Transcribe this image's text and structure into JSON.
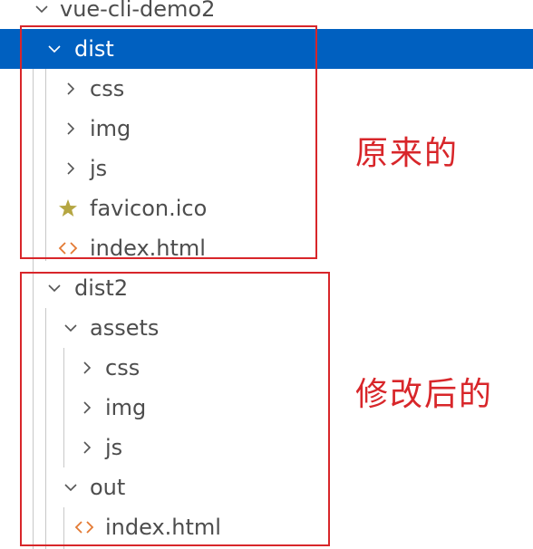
{
  "tree": {
    "root": {
      "label": "vue-cli-demo2",
      "icon": "chevron-down-icon"
    },
    "dist": {
      "label": "dist",
      "icon": "chevron-down-icon",
      "children": [
        {
          "label": "css",
          "icon": "chevron-right-icon"
        },
        {
          "label": "img",
          "icon": "chevron-right-icon"
        },
        {
          "label": "js",
          "icon": "chevron-right-icon"
        },
        {
          "label": "favicon.ico",
          "icon": "star-icon"
        },
        {
          "label": "index.html",
          "icon": "html-code-icon"
        }
      ]
    },
    "dist2": {
      "label": "dist2",
      "icon": "chevron-down-icon",
      "assets": {
        "label": "assets",
        "icon": "chevron-down-icon",
        "children": [
          {
            "label": "css",
            "icon": "chevron-right-icon"
          },
          {
            "label": "img",
            "icon": "chevron-right-icon"
          },
          {
            "label": "js",
            "icon": "chevron-right-icon"
          }
        ]
      },
      "out": {
        "label": "out",
        "icon": "chevron-down-icon",
        "children": [
          {
            "label": "index.html",
            "icon": "html-code-icon"
          }
        ]
      }
    }
  },
  "annotations": {
    "original": "原来的",
    "modified": "修改后的"
  },
  "colors": {
    "selection": "#0060c0",
    "annotation": "#d8262a",
    "text": "#4d4d4d",
    "star": "#b5a642",
    "html_icon": "#e37933"
  }
}
